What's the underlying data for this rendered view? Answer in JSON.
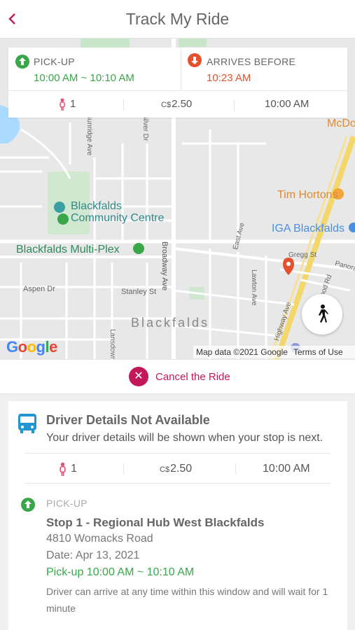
{
  "header": {
    "title": "Track My Ride",
    "back_icon": "chevron-left-icon"
  },
  "trip": {
    "pickup_label": "PICK-UP",
    "pickup_window": "10:00 AM ~ 10:10 AM",
    "arrives_label": "ARRIVES BEFORE",
    "arrives_time": "10:23 AM",
    "passengers": "1",
    "currency": "C$",
    "fare": "2.50",
    "time": "10:00 AM"
  },
  "map": {
    "labels": {
      "mcdo": "McDo",
      "tim": "Tim Hortons",
      "iga": "IGA Blackfalds",
      "community1": "Blackfalds",
      "community2": "Community Centre",
      "multiplex": "Blackfalds Multi-Plex",
      "aspen": "Aspen Dr",
      "stanley": "Stanley St",
      "town": "Blackfalds",
      "broadway": "Broadway Ave",
      "silver": "Silver Dr",
      "sunridge": "Sunridge Ave",
      "east": "East Ave",
      "lawton": "Lawton Ave",
      "highway": "Highway Ave",
      "gregg": "Gregg St",
      "panora": "Panora",
      "wood": "Wood Rd",
      "lansdowne": "Lansdowne Ave"
    },
    "google": "Google",
    "attribution": "Map data ©2021 Google",
    "terms": "Terms of Use",
    "walk_icon": "walking-person-icon"
  },
  "cancel": {
    "label": "Cancel the Ride"
  },
  "driver": {
    "title": "Driver Details Not Available",
    "subtitle": "Your driver details will be shown when your stop is next."
  },
  "stats": {
    "passengers": "1",
    "currency": "C$",
    "fare": "2.50",
    "time": "10:00 AM"
  },
  "stop": {
    "label": "PICK-UP",
    "name": "Stop 1 - Regional Hub West Blackfalds",
    "address": "4810 Womacks Road",
    "date": "Date: Apr 13, 2021",
    "window": "Pick-up 10:00 AM ~ 10:10 AM",
    "note": "Driver can arrive at any time within this window and will wait for 1 minute"
  },
  "colors": {
    "accent": "#c2185b",
    "green": "#3aa64a",
    "red": "#e4512e",
    "bus": "#2196d3"
  }
}
